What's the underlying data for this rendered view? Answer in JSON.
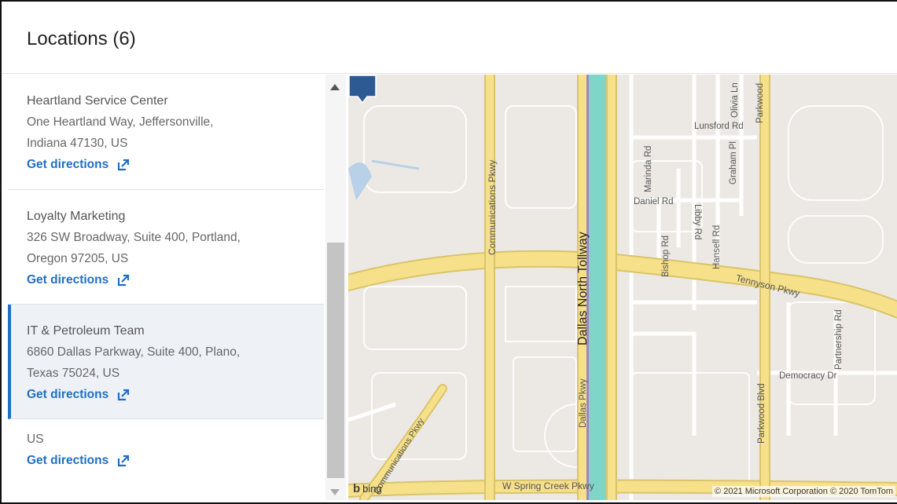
{
  "header": {
    "title": "Locations (6)"
  },
  "locations": [
    {
      "name": "Heartland Service Center",
      "address_line1": "One Heartland Way, Jeffersonville,",
      "address_line2": "Indiana 47130, US",
      "directions_label": "Get directions"
    },
    {
      "name": "Loyalty Marketing",
      "address_line1": "326 SW Broadway, Suite 400, Portland,",
      "address_line2": "Oregon 97205, US",
      "directions_label": "Get directions"
    },
    {
      "name": "IT & Petroleum Team",
      "address_line1": "6860 Dallas Parkway, Suite 400, Plano,",
      "address_line2": "Texas 75024, US",
      "directions_label": "Get directions"
    },
    {
      "name": "",
      "address_line1": "US",
      "address_line2": "",
      "directions_label": "Get directions"
    }
  ],
  "map": {
    "labels": {
      "dallas_north_tollway": "Dallas North Tollway",
      "communications_pkwy_top": "Communications Pkwy",
      "communications_pkwy_bottom": "Communications Pkwy",
      "dallas_pkwy": "Dallas Pkwy",
      "tennyson_pkwy": "Tennyson Pkwy",
      "daniel_rd": "Daniel Rd",
      "lunsford_rd": "Lunsford Rd",
      "marinda_rd": "Marinda Rd",
      "graham_pl": "Graham Pl",
      "libby_rd": "Libby Rd",
      "olivia_ln": "Olivia Ln",
      "parkwood_top": "Parkwood",
      "bishop_rd": "Bishop Rd",
      "hansell_rd": "Hansell Rd",
      "partnership_rd": "Partnership Rd",
      "democracy_dr": "Democracy Dr",
      "parkwood_blvd": "Parkwood Blvd",
      "w_spring_creek_pkwy": "W Spring Creek Pkwy"
    },
    "logo_text": "bing",
    "copyright": "© 2021 Microsoft Corporation © 2020 TomTom"
  },
  "colors": {
    "accent": "#1f6fc4",
    "active_bg": "#eef2f7",
    "marker": "#2e5a93",
    "road_major": "#f7e08a",
    "tollway": "#7fd6c8"
  }
}
